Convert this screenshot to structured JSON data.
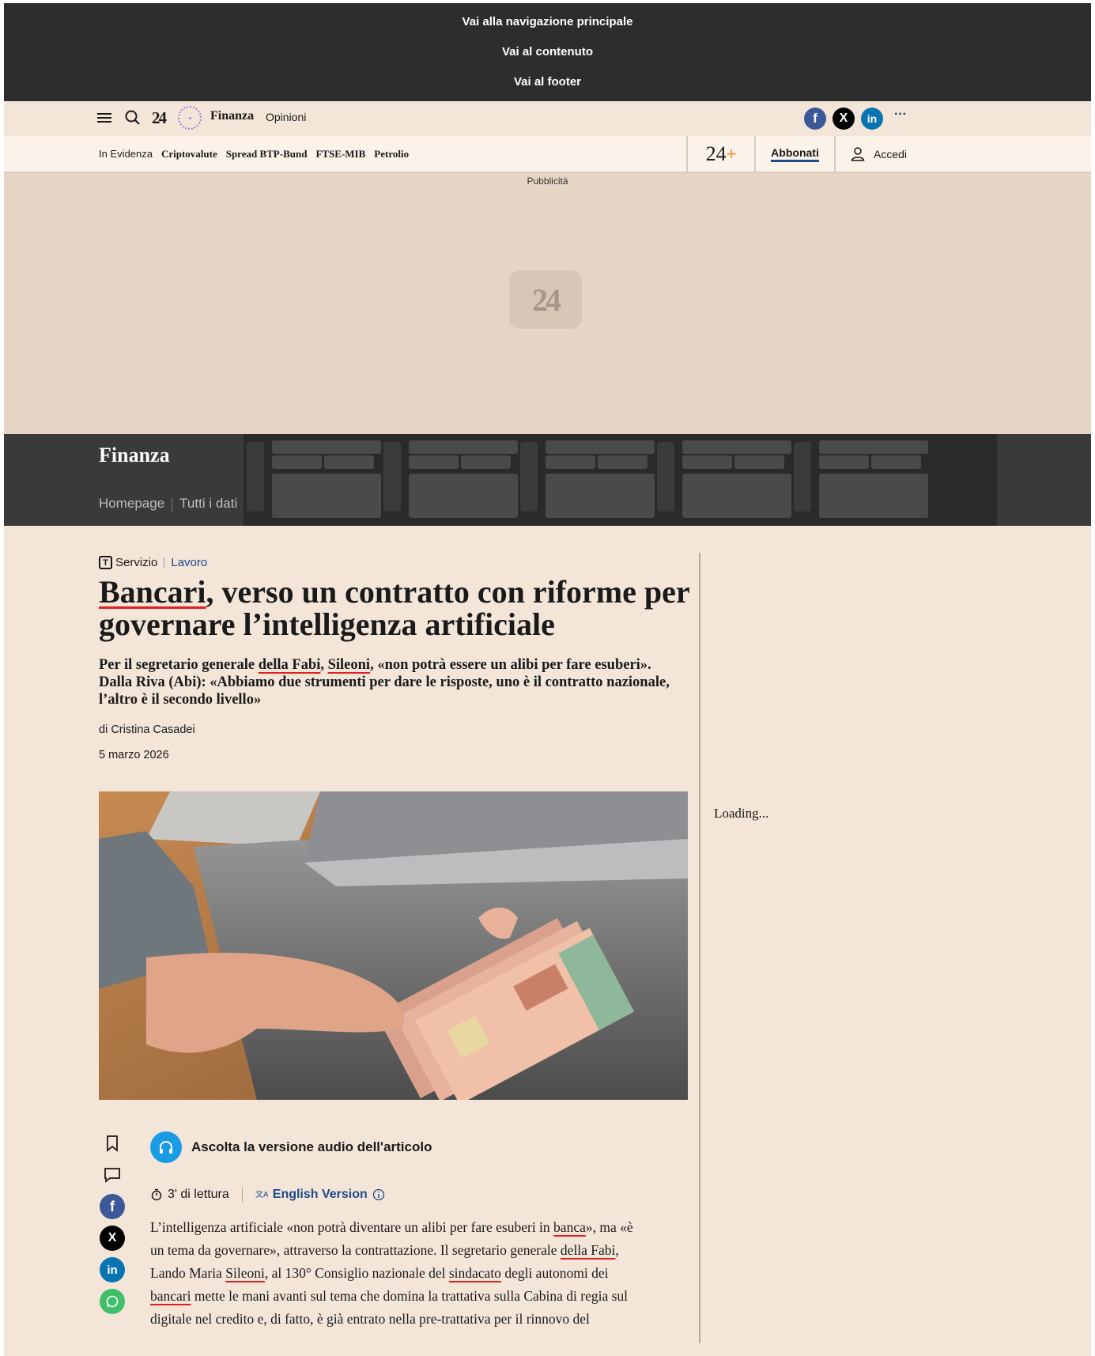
{
  "skip_links": [
    "Vai alla navigazione principale",
    "Vai al contenuto",
    "Vai al footer"
  ],
  "topbar": {
    "section": "Finanza",
    "subsection": "Opinioni",
    "more": "···"
  },
  "nav": {
    "links": [
      "In Evidenza",
      "Criptovalute",
      "Spread BTP-Bund",
      "FTSE-MIB",
      "Petrolio"
    ],
    "plus_logo": "24",
    "plus_sign": "+",
    "subscribe": "Abbonati",
    "login": "Accedi"
  },
  "ad": {
    "label": "Pubblicità",
    "logo": "24"
  },
  "section_band": {
    "title": "Finanza",
    "links": [
      "Homepage",
      "Tutti i dati"
    ]
  },
  "article": {
    "type": "Servizio",
    "category": "Lavoro",
    "title_part1": "Bancari",
    "title_part2": ", verso un contratto con riforme per governare l’intelligenza artificiale",
    "summary_a": "Per il segretario generale ",
    "summary_link1": "della Fabi",
    "summary_b": ", ",
    "summary_link2": "Sileoni",
    "summary_c": ", «non potrà essere un alibi per fare esuberi». Dalla Riva (Abi): «Abbiamo due strumenti per dare le risposte, uno è il contratto nazionale, l’altro è il secondo livello»",
    "byline": "di Cristina Casadei",
    "date": "5 marzo 2026",
    "audio_label": "Ascolta la versione audio dell'articolo",
    "reading_time": "3' di lettura",
    "english": "English Version",
    "body_a": "L’intelligenza artificiale «non potrà diventare un alibi per fare esuberi in ",
    "body_link1": "banca",
    "body_b": "», ma «è un tema da governare», attraverso la contrattazione. Il segretario generale ",
    "body_link2": "della Fabi",
    "body_c": ", Lando Maria ",
    "body_link3": "Sileoni",
    "body_d": ", al 130° Consiglio nazionale del ",
    "body_link4": "sindacato",
    "body_e": " degli autonomi dei ",
    "body_link5": "bancari",
    "body_f": " mette le mani avanti sul tema che domina la trattativa sulla Cabina di regia sul digitale nel credito e, di fatto, è già entrato nella pre-trattativa per il rinnovo del"
  },
  "sidebar": {
    "loading": "Loading..."
  },
  "colors": {
    "page_bg": "#f3e5d8",
    "dark_band": "#2d2d2d",
    "accent_blue": "#1e4a8a",
    "underline_red": "#e02020",
    "plus_orange": "#f08a24"
  }
}
